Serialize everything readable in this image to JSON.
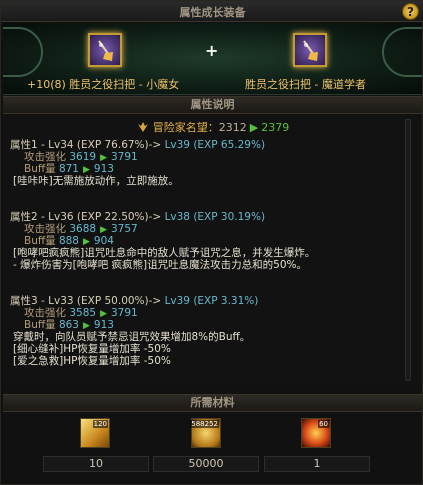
{
  "window": {
    "title": "属性成长装备",
    "help_label": "?"
  },
  "equip": {
    "left_name": "+10(8) 胜员之役扫把 - 小魔女",
    "right_name": "胜员之役扫把 - 魔道学者",
    "plus": "+"
  },
  "sections": {
    "desc": "属性说明",
    "materials": "所需材料"
  },
  "fame": {
    "label": "冒险家名望：",
    "from": "2312",
    "arrow": "▶",
    "to": "2379"
  },
  "attrs": [
    {
      "title": "属性1 - Lv34 (EXP 76.67%)-> ",
      "title_ex": "Lv39 (EXP 65.29%)",
      "stats": [
        {
          "label": "攻击强化 ",
          "from": "3619",
          "to": "3791"
        },
        {
          "label": "Buff量 ",
          "from": "871",
          "to": "913"
        }
      ],
      "notes": [
        "[哇咔咔]无需施放动作，立即施放。"
      ]
    },
    {
      "title": "属性2 - Lv36 (EXP 22.50%)-> ",
      "title_ex": "Lv38 (EXP 30.19%)",
      "stats": [
        {
          "label": "攻击强化 ",
          "from": "3688",
          "to": "3757"
        },
        {
          "label": "Buff量 ",
          "from": "888",
          "to": "904"
        }
      ],
      "notes": [
        "[咆哮吧疯疯熊]诅咒吐息命中的敌人赋予诅咒之息，并发生爆炸。",
        "- 爆炸伤害为[咆哮吧 疯疯熊]诅咒吐息魔法攻击力总和的50%。"
      ]
    },
    {
      "title": "属性3 - Lv33 (EXP 50.00%)-> ",
      "title_ex": "Lv39 (EXP 3.31%)",
      "stats": [
        {
          "label": "攻击强化 ",
          "from": "3585",
          "to": "3791"
        },
        {
          "label": "Buff量 ",
          "from": "863",
          "to": "913"
        }
      ],
      "notes": [
        "穿戴时，向队员赋予禁忌诅咒效果增加8%的Buff。",
        "[细心缝补]HP恢复量增加率 -50%",
        "[爱之急救]HP恢复量增加率 -50%"
      ]
    }
  ],
  "arrow_glyph": "▶",
  "materials": [
    {
      "icon": "gold-crystal-icon",
      "tag": "120",
      "count": "10"
    },
    {
      "icon": "gold-coin-pile-icon",
      "tag": "588252",
      "count": "50000"
    },
    {
      "icon": "fire-orb-icon",
      "tag": "60",
      "count": "1"
    }
  ]
}
